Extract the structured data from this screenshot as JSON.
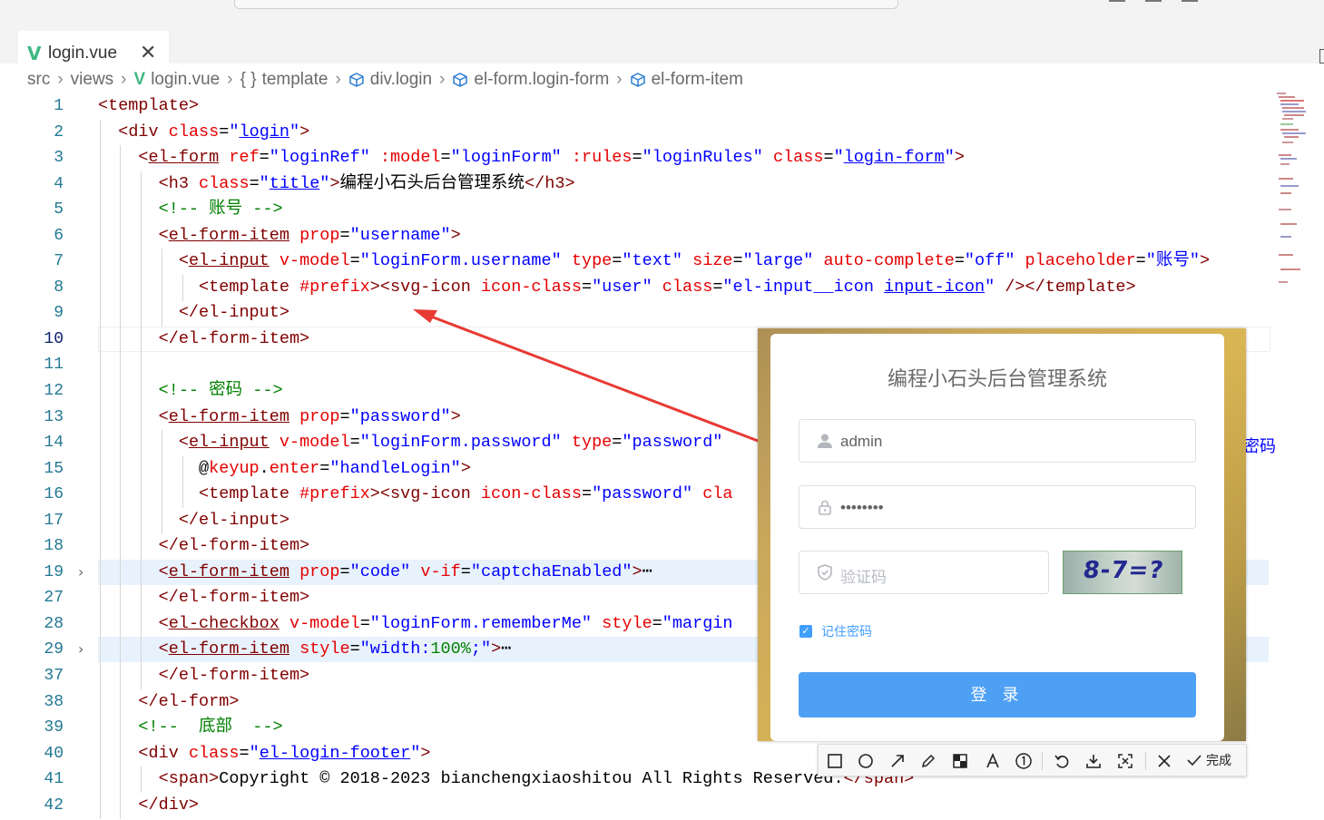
{
  "tab": {
    "title": "login.vue",
    "close": "✕"
  },
  "breadcrumb": {
    "src": "src",
    "views": "views",
    "file": "login.vue",
    "template": "template",
    "div": "div.login",
    "form": "el-form.login-form",
    "item": "el-form-item"
  },
  "code": {
    "line_numbers": [
      "1",
      "2",
      "3",
      "4",
      "5",
      "6",
      "7",
      "8",
      "9",
      "10",
      "11",
      "12",
      "13",
      "14",
      "15",
      "16",
      "17",
      "18",
      "19",
      "27",
      "28",
      "29",
      "37",
      "38",
      "39",
      "40",
      "41",
      "42"
    ],
    "active_line": "10"
  },
  "popup": {
    "title": "编程小石头后台管理系统",
    "username_value": "admin",
    "password_value": "••••••••",
    "code_placeholder": "验证码",
    "captcha_text": "8-7=?",
    "remember_label": "记住密码",
    "login_label": "登 录"
  },
  "toolbar": {
    "done_label": "完成"
  },
  "colors": {
    "tag": "#800000",
    "attribute": "#e50000",
    "string": "#0000ff",
    "comment": "#008000",
    "line_number": "#237893",
    "accent": "#409eff",
    "vue_green": "#41b883",
    "arrow": "#e83a34"
  }
}
